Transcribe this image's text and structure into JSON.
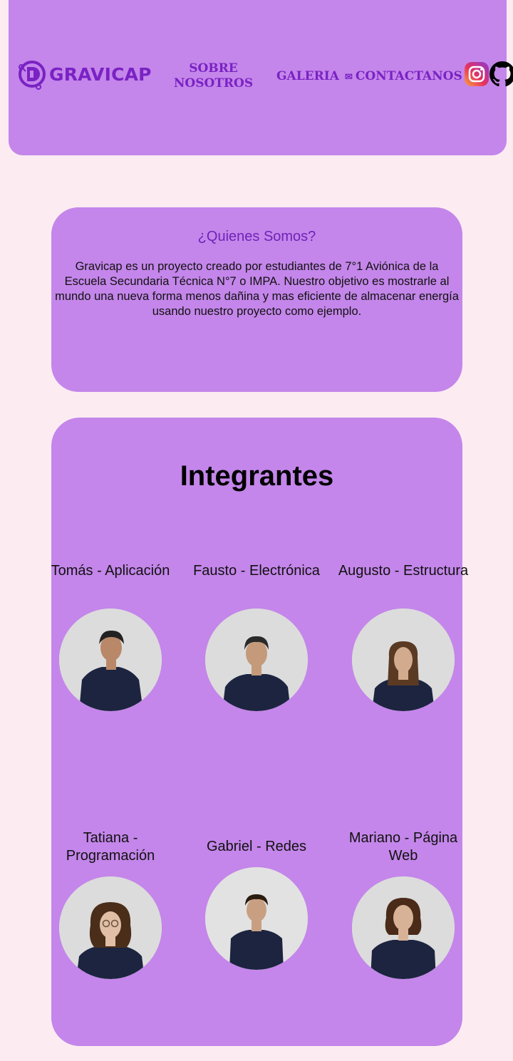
{
  "header": {
    "logo_text": "GRAVICAP",
    "nav": {
      "about": "SOBRE NOSOTROS",
      "gallery": "GALERIA",
      "contact_icon": "✉",
      "contact": "CONTACTANOS"
    },
    "icons": [
      "gravicap-logo-icon",
      "instagram-icon",
      "github-icon",
      "envelope-icon"
    ]
  },
  "about": {
    "title": "¿Quienes Somos?",
    "text": "Gravicap es un proyecto creado por estudiantes de 7°1 Aviónica de la Escuela Secundaria Técnica N°7 o IMPA. Nuestro objetivo es mostrarle al mundo una nueva forma menos dañina y mas eficiente de almacenar energía usando nuestro proyecto como ejemplo."
  },
  "team": {
    "title": "Integrantes",
    "members": [
      {
        "name": "Tomás - Aplicación"
      },
      {
        "name": "Fausto - Electrónica"
      },
      {
        "name": "Augusto - Estructura"
      },
      {
        "name": "Tatiana - Programación"
      },
      {
        "name": "Gabriel - Redes"
      },
      {
        "name": "Mariano - Página Web"
      }
    ]
  },
  "colors": {
    "background": "#fcecf2",
    "card": "#c486ea",
    "accent": "#7a22c4",
    "shirt": "#1c2440"
  }
}
